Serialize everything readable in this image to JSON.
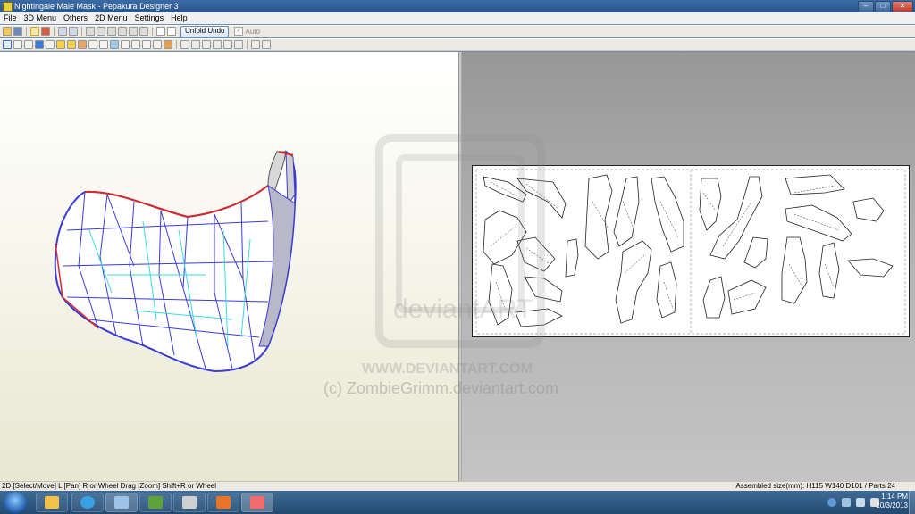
{
  "window": {
    "title": "Nightingale Male Mask - Pepakura Designer 3",
    "buttons": {
      "minimize": "–",
      "maximize": "□",
      "close": "✕"
    }
  },
  "menu": [
    "File",
    "3D Menu",
    "Others",
    "2D Menu",
    "Settings",
    "Help"
  ],
  "toolbar": {
    "unfold_undo_label": "Unfold Undo",
    "auto_label": "Auto",
    "auto_checked": true
  },
  "status": {
    "left": "2D [Select/Move] L [Pan] R or Wheel Drag [Zoom] Shift+R or Wheel",
    "right": "Assembled size(mm): H115 W140 D101 / Parts 24"
  },
  "watermark": {
    "brand": "deviantART",
    "url": "WWW.DEVIANTART.COM",
    "credit": "(c) ZombieGrimm.deviantart.com"
  },
  "taskbar": {
    "apps": [
      "windows-explorer",
      "internet-explorer",
      "pepakura-viewer",
      "green-app",
      "media-app",
      "orange-app",
      "pepakura-designer"
    ],
    "clock_time": "1:14 PM",
    "clock_date": "10/3/2013"
  },
  "colors": {
    "titlebar": "#2a5688",
    "viewport_3d": "#f8f8ef",
    "viewport_2d": "#b4b4b4",
    "mesh_blue": "#3b3bd6",
    "mesh_cyan": "#3ad9e6",
    "mesh_red": "#d92a2a"
  }
}
